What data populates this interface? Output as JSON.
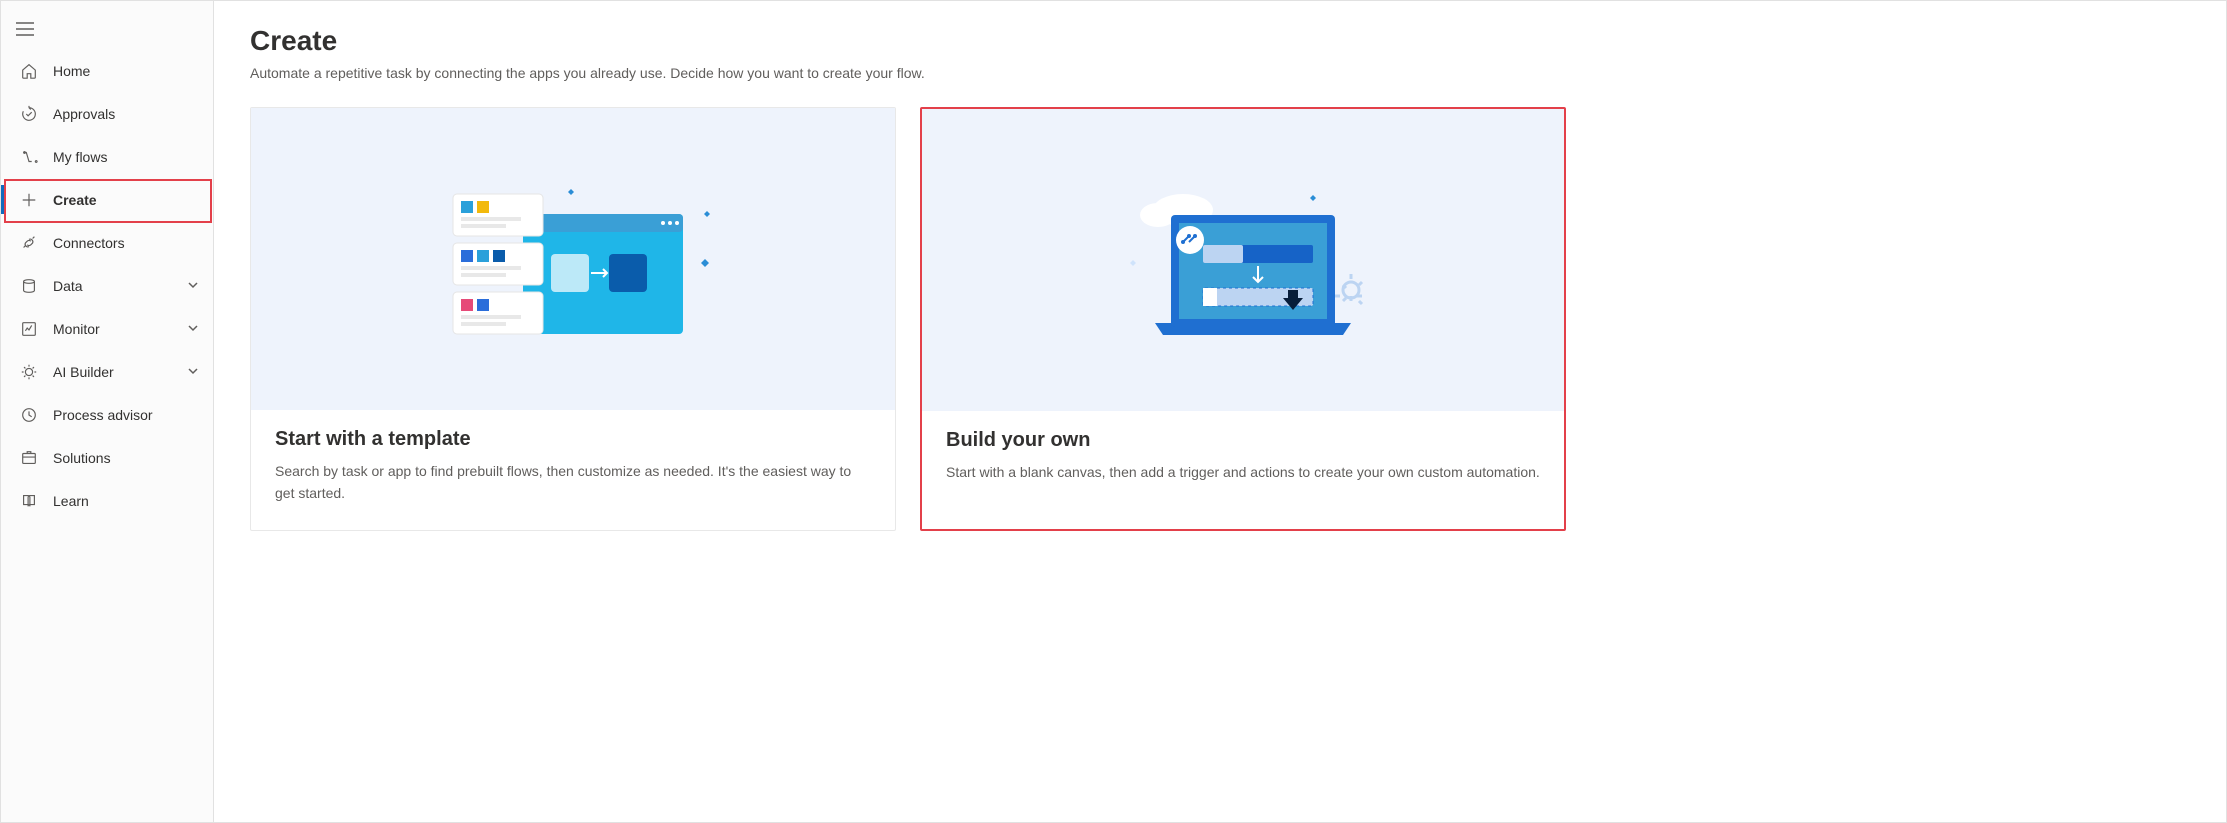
{
  "sidebar": {
    "items": [
      {
        "label": "Home",
        "icon": "home-icon",
        "expandable": false
      },
      {
        "label": "Approvals",
        "icon": "approvals-icon",
        "expandable": false
      },
      {
        "label": "My flows",
        "icon": "flows-icon",
        "expandable": false
      },
      {
        "label": "Create",
        "icon": "plus-icon",
        "expandable": false,
        "active": true
      },
      {
        "label": "Connectors",
        "icon": "connectors-icon",
        "expandable": false
      },
      {
        "label": "Data",
        "icon": "data-icon",
        "expandable": true
      },
      {
        "label": "Monitor",
        "icon": "monitor-icon",
        "expandable": true
      },
      {
        "label": "AI Builder",
        "icon": "ai-icon",
        "expandable": true
      },
      {
        "label": "Process advisor",
        "icon": "process-icon",
        "expandable": false
      },
      {
        "label": "Solutions",
        "icon": "solutions-icon",
        "expandable": false
      },
      {
        "label": "Learn",
        "icon": "learn-icon",
        "expandable": false
      }
    ]
  },
  "page": {
    "title": "Create",
    "subtitle": "Automate a repetitive task by connecting the apps you already use. Decide how you want to create your flow."
  },
  "cards": [
    {
      "title": "Start with a template",
      "desc": "Search by task or app to find prebuilt flows, then customize as needed. It's the easiest way to get started.",
      "highlight": false
    },
    {
      "title": "Build your own",
      "desc": "Start with a blank canvas, then add a trigger and actions to create your own custom automation.",
      "highlight": true
    }
  ]
}
